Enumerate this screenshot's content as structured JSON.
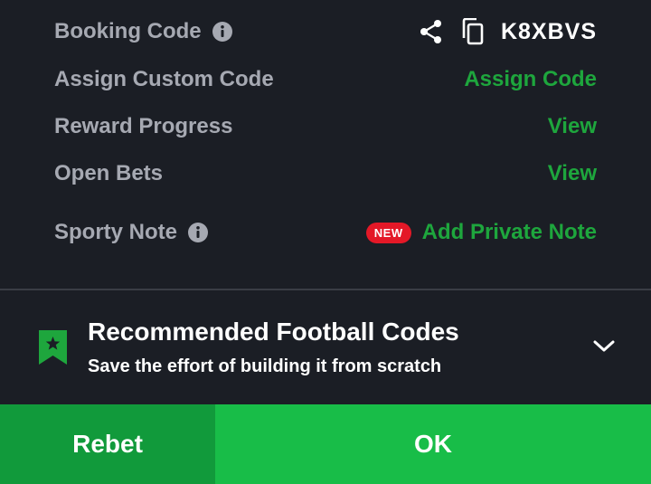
{
  "booking": {
    "label": "Booking Code",
    "code": "K8XBVS",
    "info_icon": "info-icon",
    "share_icon": "share-icon",
    "copy_icon": "copy-icon"
  },
  "custom_code": {
    "label": "Assign Custom Code",
    "action": "Assign Code"
  },
  "reward": {
    "label": "Reward Progress",
    "action": "View"
  },
  "open_bets": {
    "label": "Open Bets",
    "action": "View"
  },
  "sporty_note": {
    "label": "Sporty Note",
    "badge": "NEW",
    "action": "Add Private Note"
  },
  "recommended": {
    "title": "Recommended Football Codes",
    "subtitle": "Save the effort of building it from scratch",
    "icon": "bookmark-star-icon",
    "chevron": "chevron-down-icon"
  },
  "footer": {
    "rebet": "Rebet",
    "ok": "OK"
  },
  "colors": {
    "background": "#1b1e25",
    "label": "#a6a9b2",
    "green_link": "#1ea63d",
    "rebet_bg": "#119a3b",
    "ok_bg": "#18bd48",
    "new_badge": "#e41827"
  }
}
